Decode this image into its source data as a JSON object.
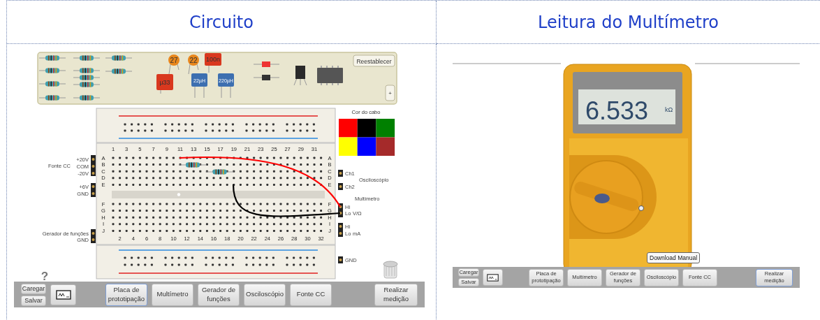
{
  "columns": [
    {
      "title": "Circuito"
    },
    {
      "title": "Leitura do Multímetro"
    }
  ],
  "circuit": {
    "tray": {
      "capacitors": [
        {
          "kind": "disc",
          "label": "27"
        },
        {
          "kind": "disc",
          "label": "22"
        },
        {
          "kind": "film",
          "label": "100n"
        },
        {
          "kind": "film",
          "label": "µ33"
        }
      ],
      "inductors": [
        {
          "label": "22µH"
        },
        {
          "label": "220µH"
        }
      ],
      "reset_button": "Reestablecer",
      "add_button": "+"
    },
    "breadboard": {
      "top_numbers": [
        "1",
        "3",
        "5",
        "7",
        "9",
        "11",
        "13",
        "15",
        "17",
        "19",
        "21",
        "23",
        "25",
        "27",
        "29",
        "31"
      ],
      "bottom_numbers": [
        "2",
        "4",
        "6",
        "8",
        "10",
        "12",
        "14",
        "16",
        "18",
        "20",
        "22",
        "24",
        "26",
        "28",
        "30",
        "32"
      ],
      "left_upper_rows": [
        "A",
        "B",
        "C",
        "D",
        "E"
      ],
      "left_lower_rows": [
        "F",
        "G",
        "H",
        "I",
        "J"
      ],
      "right_upper_rows": [
        "A",
        "B",
        "C",
        "D",
        "E"
      ],
      "right_lower_rows": [
        "F",
        "G",
        "H",
        "I",
        "J"
      ]
    },
    "power_supply": {
      "title": "Fonte CC",
      "terminals": [
        "+20V",
        "COM",
        "-20V"
      ],
      "aux_terminals": [
        "+6V",
        "GND"
      ]
    },
    "function_generator": {
      "terminals": [
        "Gerador de funções",
        "GND"
      ]
    },
    "oscilloscope": {
      "title": "Osciloscópio",
      "channels": [
        "Ch1",
        "Ch2"
      ]
    },
    "multimeter_inputs": {
      "title": "Multímetro",
      "voltage_terminals": [
        "Hi",
        "Lo"
      ],
      "voltage_mode": "V/Ω",
      "current_terminals": [
        "Hi",
        "Lo"
      ],
      "current_mode": "mA"
    },
    "ground": "GND",
    "cable_color": {
      "title": "Cor do cabo",
      "colors": [
        {
          "color": "#ff0000"
        },
        {
          "color": "#000000"
        },
        {
          "color": "#008000"
        },
        {
          "color": "#ffff00"
        },
        {
          "color": "#0000ff"
        },
        {
          "color": "#a52a2a"
        }
      ]
    },
    "wires": [
      {
        "color": "#ff0000"
      },
      {
        "color": "#000000"
      }
    ],
    "help": "?",
    "toolbar": {
      "load": "Caregar",
      "save": "Salvar",
      "tabs": [
        {
          "label": "Placa de prototipação",
          "selected": true
        },
        {
          "label": "Multímetro",
          "selected": false
        },
        {
          "label": "Gerador de funções",
          "selected": false
        },
        {
          "label": "Osciloscópio",
          "selected": false
        },
        {
          "label": "Fonte CC",
          "selected": false
        }
      ],
      "measure": {
        "label": "Realizar medição",
        "selected": false
      }
    }
  },
  "reading": {
    "value": "6.533",
    "unit": "kΩ",
    "manual_button": "Download Manual",
    "toolbar": {
      "load": "Caregar",
      "save": "Salvar",
      "tabs": [
        {
          "label": "Placa de prototipação",
          "selected": false
        },
        {
          "label": "Multímetro",
          "selected": false
        },
        {
          "label": "Gerador de funções",
          "selected": false
        },
        {
          "label": "Osciloscópio",
          "selected": false
        },
        {
          "label": "Fonte CC",
          "selected": false
        }
      ],
      "measure": {
        "label": "Realizar medição",
        "selected": true
      }
    }
  }
}
